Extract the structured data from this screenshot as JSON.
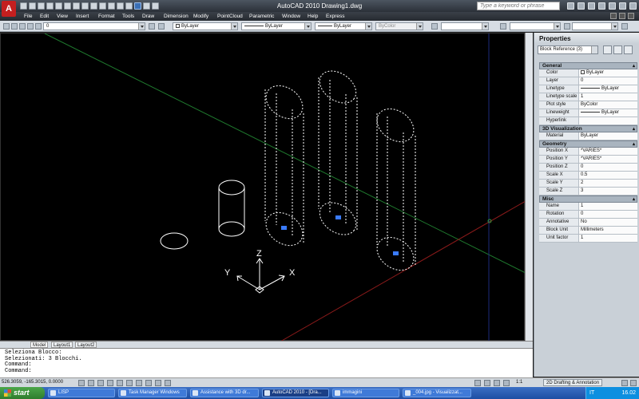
{
  "app": {
    "logo": "A",
    "title": "AutoCAD 2010    Drawing1.dwg",
    "search_placeholder": "Type a keyword or phrase"
  },
  "menu": [
    "File",
    "Edit",
    "View",
    "Insert",
    "Format",
    "Tools",
    "Draw",
    "Dimension",
    "Modify",
    "PointCloud",
    "Parametric",
    "Window",
    "Help",
    "Express"
  ],
  "toolbar": {
    "layer": "0",
    "color": "ByLayer",
    "linetype": "ByLayer",
    "lineweight": "ByLayer",
    "plotstyle": "ByColor"
  },
  "viewport": {
    "ucs": {
      "x": "X",
      "y": "Y",
      "z": "Z"
    }
  },
  "layout_tabs": [
    "Model",
    "Layout1",
    "Layout2"
  ],
  "command_lines": [
    "Seleziona Blocco:",
    "Selezionati: 3 Blocchi.",
    "Command:",
    "Command:"
  ],
  "status": {
    "coords": "526.3059, -165.3015, 0.0000",
    "scale": "1:1",
    "workspace": "2D Drafting & Annotation"
  },
  "properties": {
    "title": "Properties",
    "selection": "Block Reference (3)",
    "sections": [
      {
        "name": "General",
        "rows": [
          {
            "label": "Color",
            "value": "ByLayer",
            "kind": "color"
          },
          {
            "label": "Layer",
            "value": "0"
          },
          {
            "label": "Linetype",
            "value": "ByLayer",
            "kind": "line"
          },
          {
            "label": "Linetype scale",
            "value": "1"
          },
          {
            "label": "Plot style",
            "value": "ByColor"
          },
          {
            "label": "Lineweight",
            "value": "ByLayer",
            "kind": "line"
          },
          {
            "label": "Hyperlink",
            "value": ""
          }
        ]
      },
      {
        "name": "3D Visualization",
        "rows": [
          {
            "label": "Material",
            "value": "ByLayer"
          }
        ]
      },
      {
        "name": "Geometry",
        "rows": [
          {
            "label": "Position X",
            "value": "*VARIES*"
          },
          {
            "label": "Position Y",
            "value": "*VARIES*"
          },
          {
            "label": "Position Z",
            "value": "0"
          },
          {
            "label": "Scale X",
            "value": "0.5"
          },
          {
            "label": "Scale Y",
            "value": "2"
          },
          {
            "label": "Scale Z",
            "value": "3"
          }
        ]
      },
      {
        "name": "Misc",
        "rows": [
          {
            "label": "Name",
            "value": "1"
          },
          {
            "label": "Rotation",
            "value": "0"
          },
          {
            "label": "Annotative",
            "value": "No"
          },
          {
            "label": "Block Unit",
            "value": "Millimeters"
          },
          {
            "label": "Unit factor",
            "value": "1"
          }
        ]
      }
    ]
  },
  "taskbar": {
    "start": "start",
    "tasks": [
      "LISP",
      "Task Manager Windows",
      "Assistance with 3D dr...",
      "AutoCAD 2010 - [Dra...",
      "immagini",
      "_004.jpg - Visualizzat..."
    ],
    "lang": "IT",
    "time": "16.02"
  },
  "colors": {
    "viewport_bg": "#000000",
    "axis_green": "#1f7a2e",
    "axis_red": "#8a1a1a",
    "grip_blue": "#3a7bff"
  }
}
